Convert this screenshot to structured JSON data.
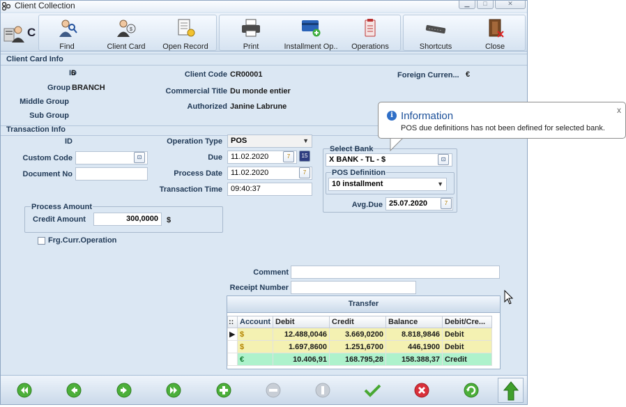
{
  "window": {
    "title": "Client Collection"
  },
  "toolbar": {
    "partial_label": "C",
    "buttons": [
      {
        "label": "Find",
        "icon": "find-person-icon"
      },
      {
        "label": "Client Card",
        "icon": "client-card-icon"
      },
      {
        "label": "Open Record",
        "icon": "open-record-icon"
      },
      {
        "label": "Print",
        "icon": "printer-icon"
      },
      {
        "label": "Installment Op..",
        "icon": "credit-card-add-icon"
      },
      {
        "label": "Operations",
        "icon": "clipboard-icon"
      },
      {
        "label": "Shortcuts",
        "icon": "keyboard-icon"
      },
      {
        "label": "Close",
        "icon": "door-exit-icon"
      }
    ]
  },
  "client_card": {
    "section_title": "Client Card Info",
    "id_label": "ID",
    "id_value": "6",
    "group_label": "Group",
    "group_value": "BRANCH",
    "middle_group_label": "Middle Group",
    "sub_group_label": "Sub Group",
    "client_code_label": "Client Code",
    "client_code_value": "CR00001",
    "commercial_title_label": "Commercial Title",
    "commercial_title_value": "Du monde entier",
    "authorized_label": "Authorized",
    "authorized_value": "Janine Labrune",
    "foreign_currency_label": "Foreign Curren...",
    "foreign_currency_value": "€"
  },
  "transaction": {
    "section_title": "Transaction Info",
    "id_label": "ID",
    "custom_code_label": "Custom Code",
    "custom_code_value": "",
    "document_no_label": "Document No",
    "document_no_value": "",
    "operation_type_label": "Operation Type",
    "operation_type_value": "POS",
    "due_label": "Due",
    "due_value": "11.02.2020",
    "process_date_label": "Process Date",
    "process_date_value": "11.02.2020",
    "transaction_time_label": "Transaction Time",
    "transaction_time_value": "09:40:37",
    "calendar_icon_text": "7",
    "calendar_alt_icon_text": "15"
  },
  "process_amount": {
    "group_title": "Process Amount",
    "credit_amount_label": "Credit Amount",
    "credit_amount_value": "300,0000",
    "currency": "$"
  },
  "foreign_currency_operation": {
    "label": "Frg.Curr.Operation",
    "checked": false
  },
  "bank": {
    "select_bank_label": "Select Bank",
    "select_bank_value": "X BANK - TL - $",
    "pos_definition_label": "POS Definition",
    "pos_definition_value": "10 installment",
    "avg_due_label": "Avg.Due",
    "avg_due_value": "25.07.2020"
  },
  "comment": {
    "label": "Comment",
    "value": ""
  },
  "receipt_number": {
    "label": "Receipt Number",
    "value": ""
  },
  "grid": {
    "header_button": "Transfer",
    "row_indicator_header": "::",
    "columns": [
      "Account",
      "Debit",
      "Credit",
      "Balance",
      "Debit/Cre..."
    ],
    "rows": [
      {
        "account": "$",
        "debit": "12.488,0046",
        "credit": "3.669,0200",
        "balance": "8.818,9846",
        "type": "Debit"
      },
      {
        "account": "$",
        "debit": "1.697,8600",
        "credit": "1.251,6700",
        "balance": "446,1900",
        "type": "Debit"
      },
      {
        "account": "€",
        "debit": "10.406,91",
        "credit": "168.795,28",
        "balance": "158.388,37",
        "type": "Credit"
      }
    ]
  },
  "tooltip": {
    "title": "Information",
    "message": "POS due definitions has not been defined for selected bank.",
    "close_symbol": "x"
  },
  "colors": {
    "accent": "#213a57",
    "row_yellow": "#f4f1b2",
    "row_green": "#aef2cc",
    "nav_green": "#4caf3a",
    "cancel_red": "#d9303a"
  }
}
